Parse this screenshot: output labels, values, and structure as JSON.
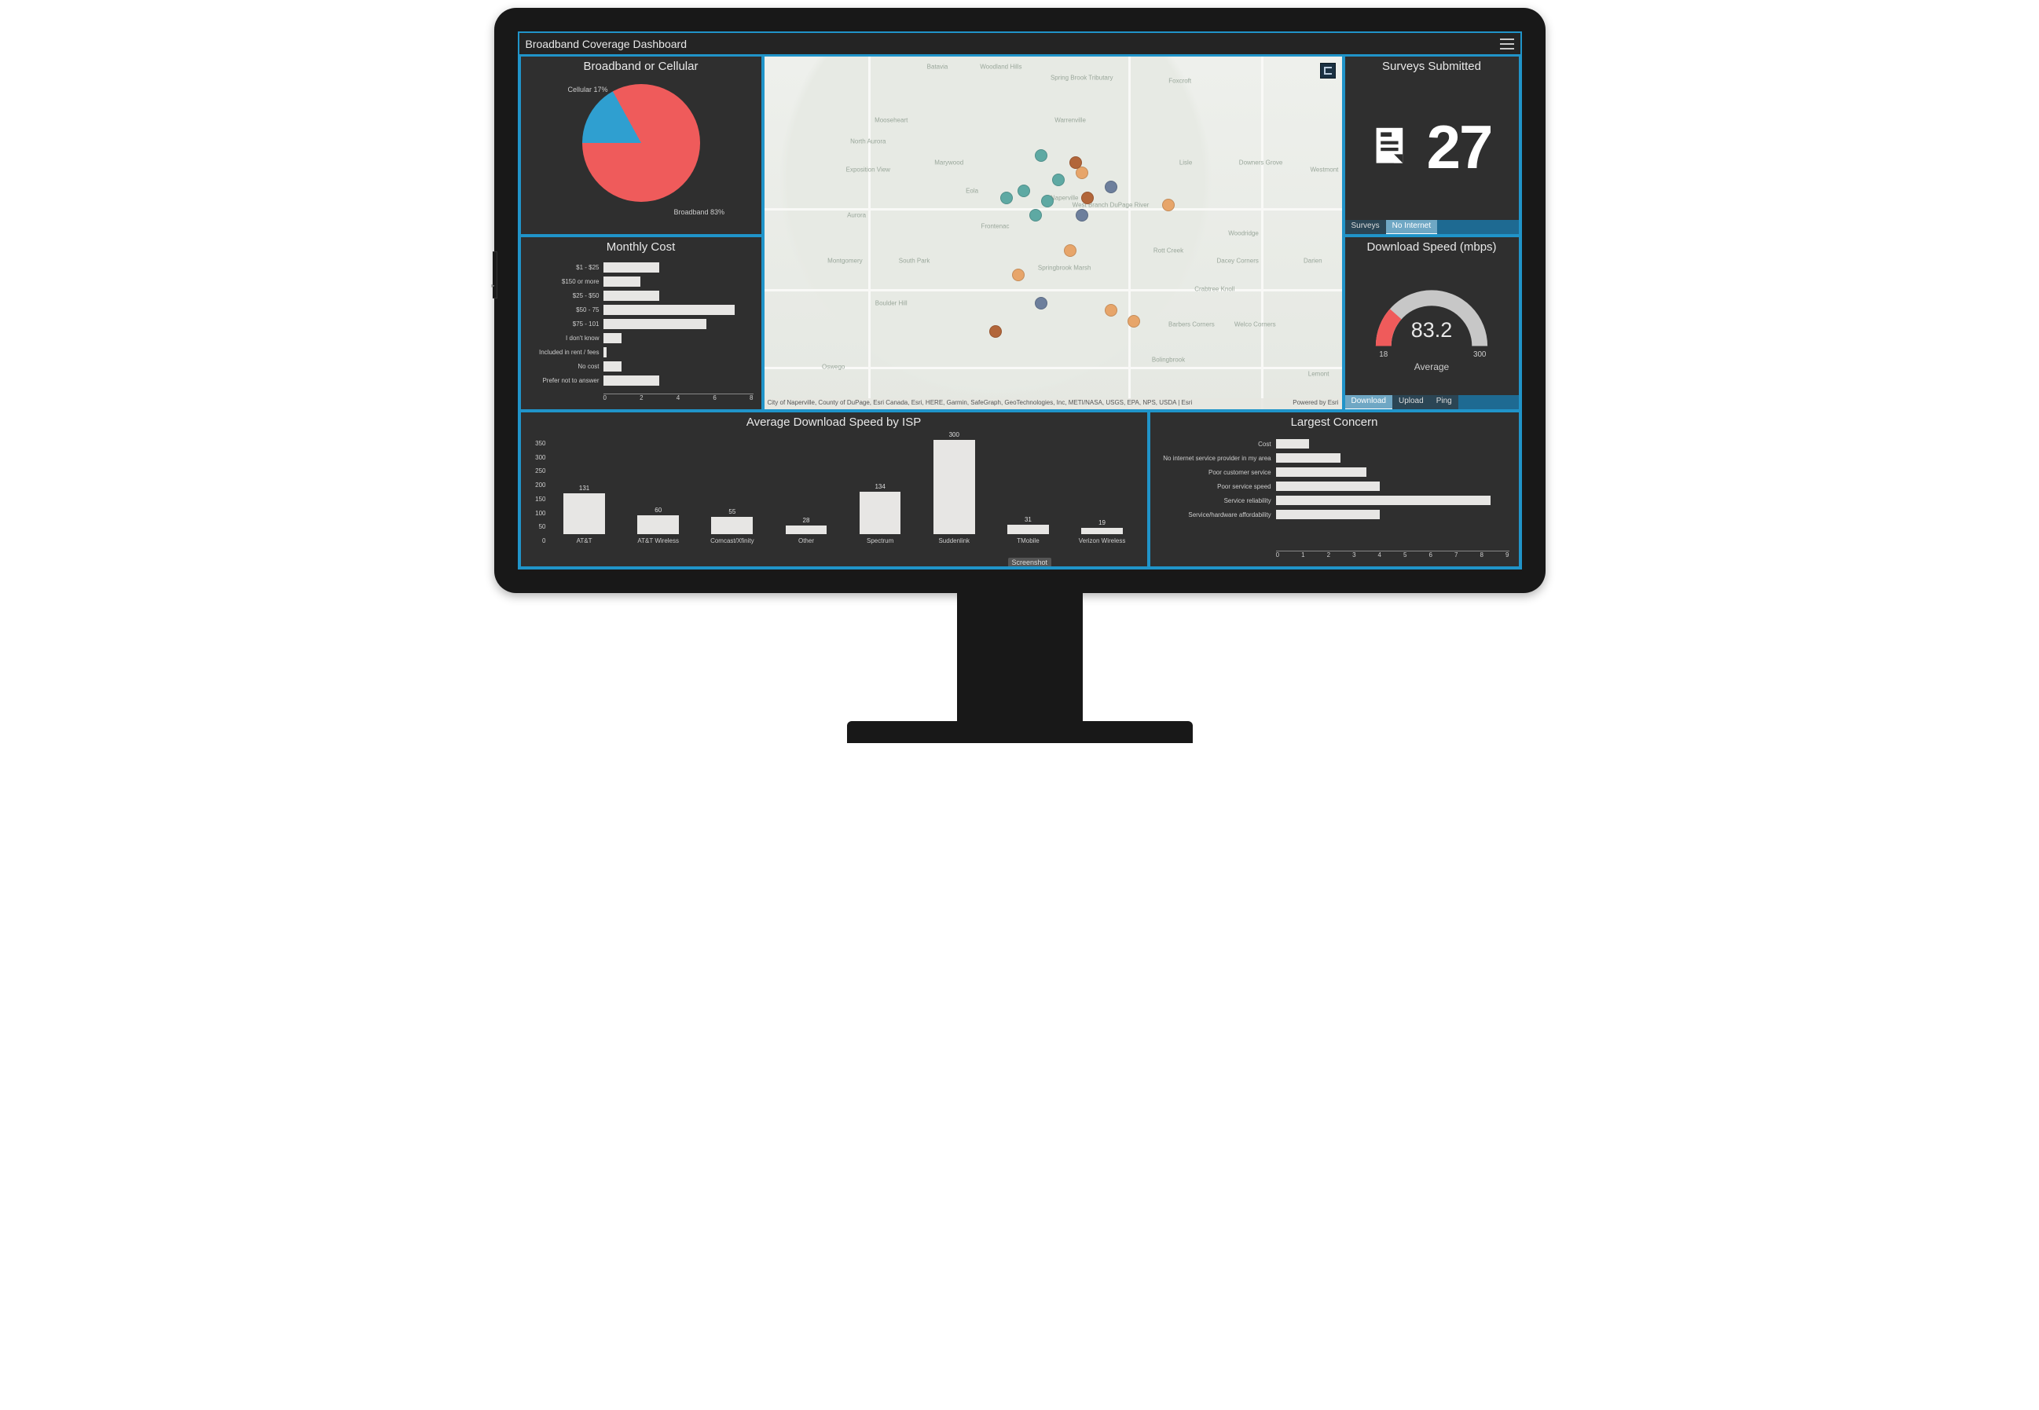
{
  "header": {
    "title": "Broadband Coverage Dashboard"
  },
  "panels": {
    "pie": {
      "title": "Broadband or Cellular"
    },
    "cost": {
      "title": "Monthly Cost"
    },
    "surveys": {
      "title": "Surveys Submitted",
      "count": "27",
      "tabs": [
        "Surveys",
        "No Internet"
      ],
      "active_tab": 1
    },
    "gauge": {
      "title": "Download Speed (mbps)",
      "value": "83.2",
      "min": "18",
      "max": "300",
      "caption": "Average",
      "tabs": [
        "Download",
        "Upload",
        "Ping"
      ],
      "active_tab": 0
    },
    "isp": {
      "title": "Average Download Speed by ISP"
    },
    "concern": {
      "title": "Largest Concern"
    }
  },
  "map": {
    "locations": [
      "Batavia",
      "Woodland Hills",
      "Spring Brook Tributary",
      "Foxcroft",
      "Mooseheart",
      "North Aurora",
      "Warrenville",
      "Exposition View",
      "Marywood",
      "Lisle",
      "Downers Grove",
      "Westmont",
      "Eola",
      "Naperville",
      "West Branch DuPage River",
      "Aurora",
      "Frontenac",
      "Woodridge",
      "Montgomery",
      "South Park",
      "Springbrook Marsh",
      "Rott Creek",
      "Dacey Corners",
      "Darien",
      "Boulder Hill",
      "Crabtree Knoll",
      "Barbers Corners",
      "Welco Corners",
      "Oswego",
      "Bolingbrook",
      "Lemont"
    ],
    "credit": "City of Naperville, County of DuPage, Esri Canada, Esri, HERE, Garmin, SafeGraph, GeoTechnologies, Inc, METI/NASA, USGS, EPA, NPS, USDA | Esri",
    "powered": "Powered by Esri"
  },
  "misc": {
    "screenshot_tooltip": "Screenshot"
  },
  "chart_data": [
    {
      "id": "pie_connection",
      "type": "pie",
      "title": "Broadband or Cellular",
      "categories": [
        "Broadband",
        "Cellular"
      ],
      "values": [
        83,
        17
      ],
      "value_labels": [
        "Broadband 83%",
        "Cellular 17%"
      ],
      "colors": [
        "#ef5b5b",
        "#2f9fd0"
      ]
    },
    {
      "id": "cost_hbar",
      "type": "bar",
      "orientation": "horizontal",
      "title": "Monthly Cost",
      "categories": [
        "$1 - $25",
        "$150 or more",
        "$25 - $50",
        "$50 - 75",
        "$75 - 101",
        "I don't know",
        "Included in rent / fees",
        "No cost",
        "Prefer not to answer"
      ],
      "values": [
        3,
        2,
        3,
        7,
        5.5,
        1,
        0.2,
        1,
        3
      ],
      "xlim": [
        0,
        8
      ],
      "xticks": [
        0,
        2,
        4,
        6,
        8
      ]
    },
    {
      "id": "isp_vbar",
      "type": "bar",
      "title": "Average Download Speed by ISP",
      "categories": [
        "AT&T",
        "AT&T Wireless",
        "Comcast/Xfinity",
        "Other",
        "Spectrum",
        "Suddenlink",
        "TMobile",
        "Verizon Wireless"
      ],
      "values": [
        131,
        60,
        55,
        28,
        134,
        300,
        31,
        19
      ],
      "ylim": [
        0,
        350
      ],
      "yticks": [
        0,
        50,
        100,
        150,
        200,
        250,
        300,
        350
      ]
    },
    {
      "id": "concern_hbar",
      "type": "bar",
      "orientation": "horizontal",
      "title": "Largest Concern",
      "categories": [
        "Cost",
        "No internet service provider in my area",
        "Poor customer service",
        "Poor service speed",
        "Service reliability",
        "Service/hardware affordability"
      ],
      "values": [
        1.3,
        2.5,
        3.5,
        4,
        8.3,
        4
      ],
      "xlim": [
        0,
        9
      ],
      "xticks": [
        0,
        1,
        2,
        3,
        4,
        5,
        6,
        7,
        8,
        9
      ]
    },
    {
      "id": "gauge_speed",
      "type": "gauge",
      "title": "Download Speed (mbps)",
      "value": 83.2,
      "min": 18,
      "max": 300,
      "caption": "Average"
    },
    {
      "id": "map_points",
      "type": "scatter",
      "note": "approximate pixel positions within map panel (0-100%)",
      "series": [
        {
          "name": "teal",
          "color": "#5ea9a3",
          "points": [
            [
              48,
              28
            ],
            [
              45,
              38
            ],
            [
              42,
              40
            ],
            [
              47,
              45
            ],
            [
              49,
              41
            ],
            [
              51,
              35
            ]
          ]
        },
        {
          "name": "orange",
          "color": "#e7a56a",
          "points": [
            [
              55,
              33
            ],
            [
              70,
              42
            ],
            [
              53,
              55
            ],
            [
              44,
              62
            ],
            [
              60,
              72
            ],
            [
              64,
              75
            ]
          ]
        },
        {
          "name": "brown",
          "color": "#b2663a",
          "points": [
            [
              54,
              30
            ],
            [
              56,
              40
            ],
            [
              40,
              78
            ]
          ]
        },
        {
          "name": "steel",
          "color": "#6d7f9c",
          "points": [
            [
              60,
              37
            ],
            [
              55,
              45
            ],
            [
              48,
              70
            ]
          ]
        }
      ]
    }
  ]
}
